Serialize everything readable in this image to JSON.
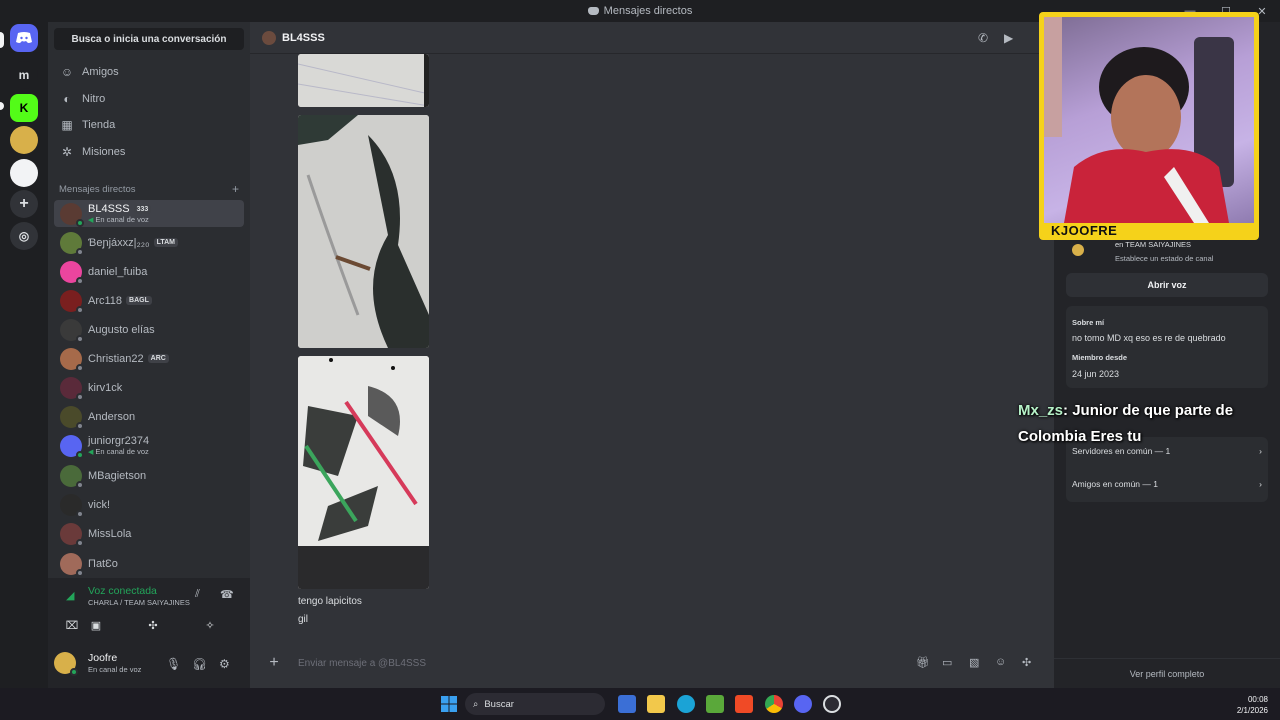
{
  "titlebar": {
    "title": "Mensajes directos"
  },
  "servers": [
    {
      "label": "m"
    }
  ],
  "sidebar": {
    "search_label": "Busca o inicia una conversación",
    "nav": [
      {
        "label": "Amigos",
        "icon": "friends-icon"
      },
      {
        "label": "Nitro",
        "icon": "nitro-icon"
      },
      {
        "label": "Tienda",
        "icon": "shop-icon"
      },
      {
        "label": "Misiones",
        "icon": "quests-icon"
      }
    ],
    "dm_header": "Mensajes directos",
    "dms": [
      {
        "name": "BL4SSS",
        "tag": "333",
        "sub": "En canal de voz",
        "color": "#5a3b33",
        "active": true
      },
      {
        "name": "Ɓeɲjáxxz|₂₂₀",
        "tag": "LTAM",
        "sub": "",
        "color": "#5f7a3a"
      },
      {
        "name": "daniel_fuiba",
        "tag": "",
        "sub": "",
        "color": "#eb459e"
      },
      {
        "name": "Arc118",
        "tag": "BAGL",
        "sub": "",
        "color": "#7a1f1f"
      },
      {
        "name": "Augusto elías",
        "tag": "",
        "sub": "",
        "color": "#3a3a3a"
      },
      {
        "name": "Christian22",
        "tag": "ARC",
        "sub": "",
        "color": "#a66a4a"
      },
      {
        "name": "kirv1ck",
        "tag": "",
        "sub": "",
        "color": "#5a2a3a"
      },
      {
        "name": "Anderson",
        "tag": "",
        "sub": "",
        "color": "#4a4a2a"
      },
      {
        "name": "juniorgr2374",
        "tag": "",
        "sub": "En canal de voz",
        "color": "#5865f2"
      },
      {
        "name": "MBagietson",
        "tag": "",
        "sub": "",
        "color": "#4a6a3a"
      },
      {
        "name": "vick!",
        "tag": "",
        "sub": "",
        "color": "#2a2a2a"
      },
      {
        "name": "MissLola",
        "tag": "",
        "sub": "",
        "color": "#6a3a3a"
      },
      {
        "name": "ΠatƐo",
        "tag": "",
        "sub": "",
        "color": "#a06a5a"
      }
    ],
    "voice": {
      "title": "Voz conectada",
      "sub": "CHARLA / TEAM SAIYAJINES"
    },
    "user": {
      "name": "Joofre",
      "sub": "En canal de voz"
    }
  },
  "chat": {
    "recipient": "BL4SSS",
    "messages": [
      "tengo lapicitos",
      "gil"
    ],
    "composer_placeholder": "Enviar mensaje a @BL4SSS"
  },
  "profile": {
    "server_line": "en TEAM SAIYAJINES",
    "status_line": "Establece un estado de canal",
    "open_voice": "Abrir voz",
    "about_label": "Sobre mí",
    "about_text": "no tomo MD xq eso es re de quebrado",
    "member_label": "Miembro desde",
    "member_since": "24 jun 2023",
    "mutual_servers": "Servidores en común — 1",
    "mutual_friends": "Amigos en común — 1",
    "full_profile": "Ver perfil completo"
  },
  "stream_overlay": {
    "cam_name": "KJOOFRE",
    "chat_user": "Mx_zs",
    "chat_text": ": Junior de que parte de Colombia Eres tu"
  },
  "taskbar": {
    "search": "Buscar",
    "time": "00:08",
    "date": "2/1/2026"
  }
}
